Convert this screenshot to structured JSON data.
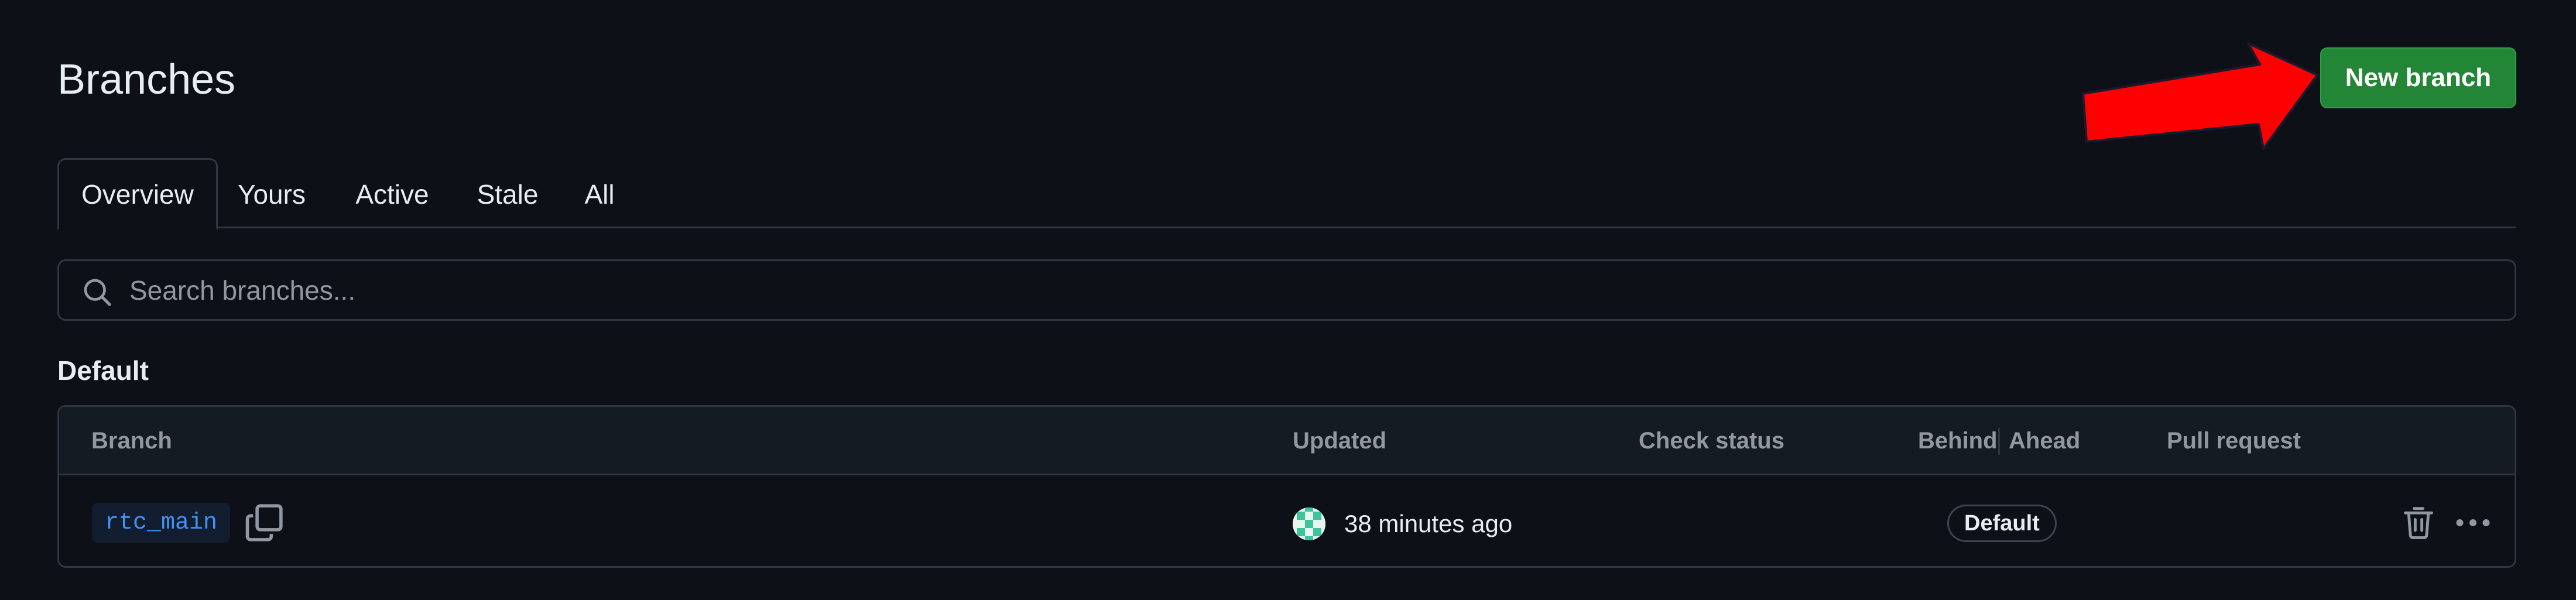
{
  "header": {
    "title": "Branches",
    "new_branch_label": "New branch"
  },
  "tabs": [
    {
      "label": "Overview",
      "active": true
    },
    {
      "label": "Yours",
      "active": false
    },
    {
      "label": "Active",
      "active": false
    },
    {
      "label": "Stale",
      "active": false
    },
    {
      "label": "All",
      "active": false
    }
  ],
  "search": {
    "placeholder": "Search branches...",
    "icon": "search-icon"
  },
  "default_section": {
    "title": "Default",
    "columns": {
      "branch": "Branch",
      "updated": "Updated",
      "check_status": "Check status",
      "behind": "Behind",
      "ahead": "Ahead",
      "pull_request": "Pull request"
    },
    "rows": [
      {
        "branch": "rtc_main",
        "updated": "38 minutes ago",
        "badge": "Default",
        "icons": [
          "copy-icon",
          "avatar",
          "trash-icon",
          "kebab-icon"
        ]
      }
    ]
  },
  "colors": {
    "background": "#0d1117",
    "primary_button": "#238636",
    "link": "#4493f8",
    "border": "#30363d",
    "annotation_arrow": "#ff0000"
  }
}
